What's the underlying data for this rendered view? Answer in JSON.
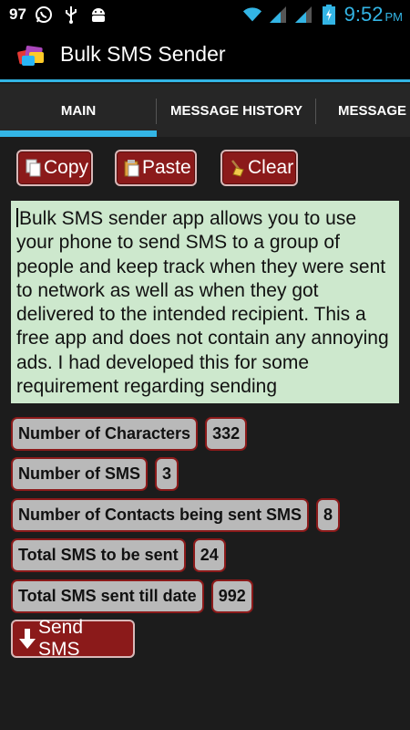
{
  "status_bar": {
    "notification_count": "97",
    "icons_left": [
      "whatsapp-icon",
      "usb-icon",
      "android-icon"
    ],
    "icons_right": [
      "wifi-icon",
      "signal-icon",
      "signal-icon",
      "battery-charging-icon"
    ],
    "time": "9:52",
    "ampm": "PM"
  },
  "action_bar": {
    "title": "Bulk SMS Sender",
    "icon": "app-logo-icon"
  },
  "tabs": [
    {
      "label": "MAIN",
      "selected": true
    },
    {
      "label": "MESSAGE HISTORY",
      "selected": false
    },
    {
      "label": "MESSAGE S",
      "selected": false
    }
  ],
  "buttons": {
    "copy": {
      "label": "Copy",
      "icon": "copy-icon"
    },
    "paste": {
      "label": "Paste",
      "icon": "paste-icon"
    },
    "clear": {
      "label": "Clear",
      "icon": "broom-icon"
    }
  },
  "message_text": "Bulk SMS sender app allows you to use your phone to send SMS to a group of people and keep track when they were sent to network as well as when they got delivered to the intended recipient. This a free app and does not contain any annoying ads. I had developed this for some requirement regarding sending",
  "stats": [
    {
      "label": "Number of Characters",
      "value": "332"
    },
    {
      "label": "Number of SMS",
      "value": "3"
    },
    {
      "label": "Number of Contacts being sent SMS",
      "value": "8"
    },
    {
      "label": "Total SMS to be sent",
      "value": "24"
    },
    {
      "label": "Total SMS sent till date",
      "value": "992"
    }
  ],
  "send_button": {
    "label": "Send SMS",
    "icon": "arrow-down-icon"
  },
  "colors": {
    "accent": "#33b5e5",
    "button_bg": "#8b1a1a",
    "message_bg": "#cde8cd",
    "chip_bg": "#b9b9b9"
  }
}
